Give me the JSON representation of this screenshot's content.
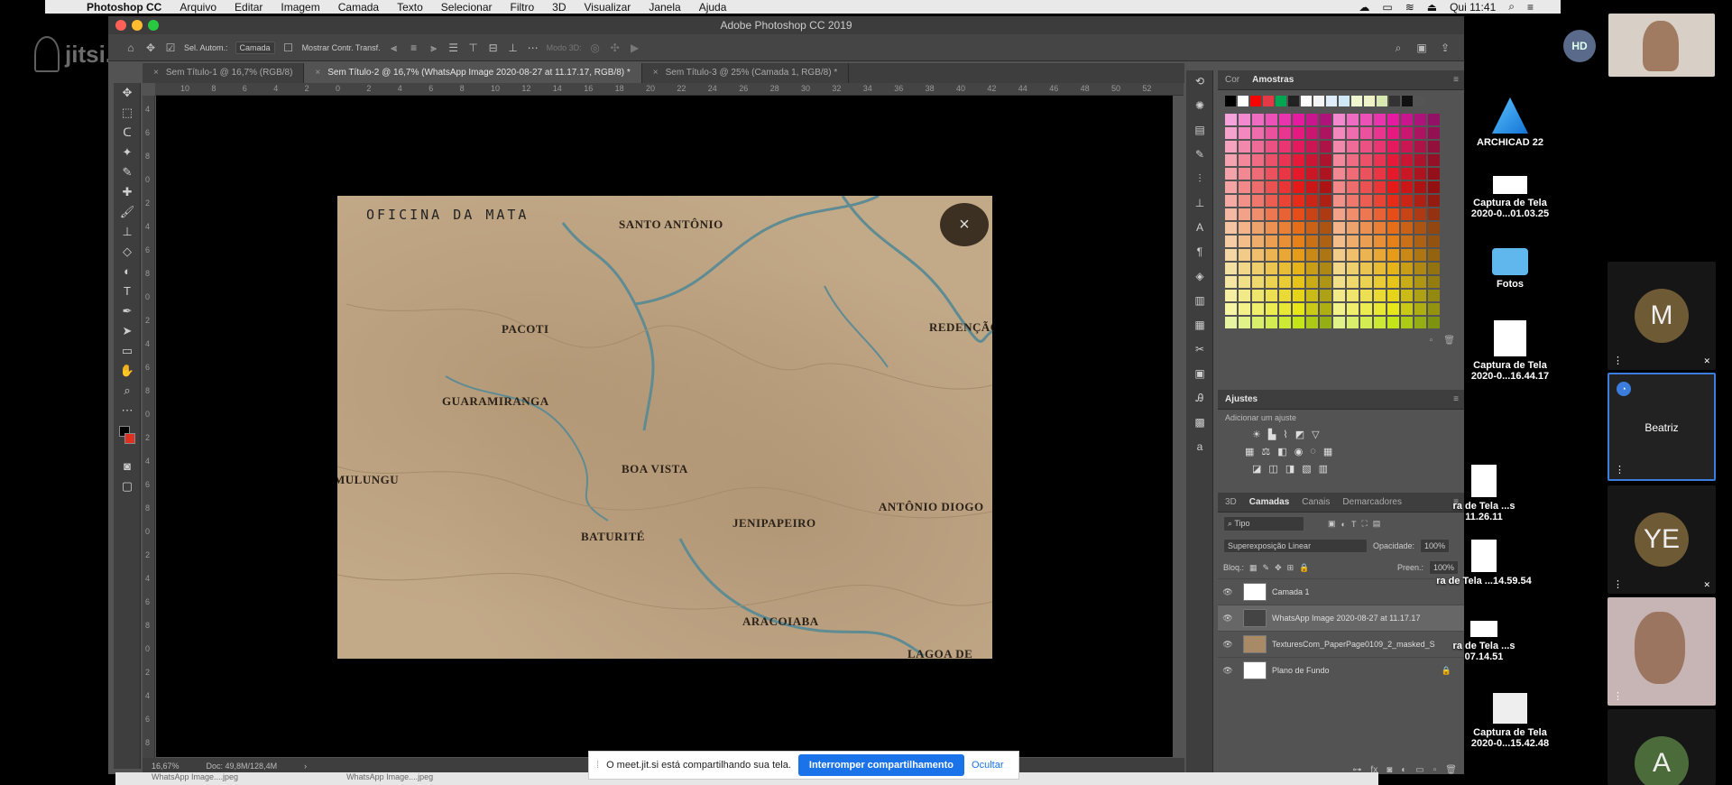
{
  "menubar": {
    "app": "Photoshop CC",
    "items": [
      "Arquivo",
      "Editar",
      "Imagem",
      "Camada",
      "Texto",
      "Selecionar",
      "Filtro",
      "3D",
      "Visualizar",
      "Janela",
      "Ajuda"
    ],
    "clock": "Qui 11:41"
  },
  "jitsi": {
    "logo": "jitsi.org"
  },
  "window": {
    "title": "Adobe Photoshop CC 2019"
  },
  "options": {
    "auto_select_label": "Sel. Autom.:",
    "auto_select_value": "Camada",
    "show_transform_label": "Mostrar Contr. Transf.",
    "mode_3d": "Modo 3D:"
  },
  "tabs": [
    {
      "label": "Sem Título-1 @ 16,7% (RGB/8)",
      "active": false
    },
    {
      "label": "Sem Título-2 @ 16,7% (WhatsApp Image 2020-08-27 at 11.17.17, RGB/8) *",
      "active": true
    },
    {
      "label": "Sem Título-3 @ 25% (Camada 1, RGB/8) *",
      "active": false
    }
  ],
  "ruler_top": [
    "10",
    "8",
    "6",
    "4",
    "2",
    "0",
    "2",
    "4",
    "6",
    "8",
    "10",
    "12",
    "14",
    "16",
    "18",
    "20",
    "22",
    "24",
    "26",
    "28",
    "30",
    "32",
    "34",
    "36",
    "38",
    "40",
    "42",
    "44",
    "46",
    "48",
    "50",
    "52"
  ],
  "ruler_left": [
    "4",
    "6",
    "8",
    "0",
    "2",
    "4",
    "6",
    "8",
    "0",
    "2",
    "4",
    "6",
    "8",
    "0",
    "2",
    "4",
    "6",
    "8",
    "0",
    "2",
    "4",
    "6",
    "8",
    "0",
    "2",
    "4",
    "6",
    "8"
  ],
  "map": {
    "title": "OFICINA DA MATA",
    "close": "×",
    "places": [
      "SANTO ANTÔNIO",
      "PACOTI",
      "REDENÇÃO",
      "GUARAMIRANGA",
      "MULUNGU",
      "BOA VISTA",
      "ANTÔNIO DIOGO",
      "JENIPAPEIRO",
      "BATURITÉ",
      "ARACOIABA",
      "LAGOA DE"
    ]
  },
  "status": {
    "zoom": "16,67%",
    "doc": "Doc: 49,8M/128,4M"
  },
  "panels": {
    "color_tab": "Cor",
    "swatches_tab": "Amostras",
    "adjust_title": "Ajustes",
    "adjust_sub": "Adicionar um ajuste",
    "layers_tabs": [
      "3D",
      "Camadas",
      "Canais",
      "Demarcadores"
    ],
    "kind": "Tipo",
    "blend": "Superexposição Linear",
    "opacity_label": "Opacidade:",
    "opacity": "100%",
    "lock_label": "Bloq.:",
    "fill_label": "Preen.:",
    "fill": "100%",
    "layers": [
      {
        "name": "Camada 1",
        "selected": false,
        "thumb": "#ffffff"
      },
      {
        "name": "WhatsApp Image 2020-08-27 at 11.17.17",
        "selected": true,
        "thumb": "#444444"
      },
      {
        "name": "TexturesCom_PaperPage0109_2_masked_S",
        "selected": false,
        "thumb": "#a88a66"
      },
      {
        "name": "Plano de Fundo",
        "selected": false,
        "thumb": "#ffffff"
      }
    ]
  },
  "desktop": [
    {
      "label": "ARCHICAD 22"
    },
    {
      "label": "Captura de Tela 2020-0...01.03.25"
    },
    {
      "label": "Fotos"
    },
    {
      "label": "Captura de Tela 2020-0...16.44.17"
    },
    {
      "label": "ra de Tela ...s 11.26.11"
    },
    {
      "label": "ra de Tela ...14.59.54"
    },
    {
      "label": "ra de Tela ...s 07.14.51"
    },
    {
      "label": "Captura de Tela 2020-0...15.42.48"
    }
  ],
  "participants": {
    "hd": "HD",
    "m": "M",
    "beatriz": "Beatriz",
    "ye": "YE",
    "a": "A"
  },
  "sharebar": {
    "text": "O meet.jit.si está compartilhando sua tela.",
    "stop": "Interromper compartilhamento",
    "hide": "Ocultar"
  },
  "bottom": [
    "WhatsApp Image....jpeg",
    "WhatsApp Image....jpeg"
  ],
  "colors": {
    "accent": "#1a73e8",
    "ps_bg": "#535353",
    "map": "#c2a988"
  }
}
